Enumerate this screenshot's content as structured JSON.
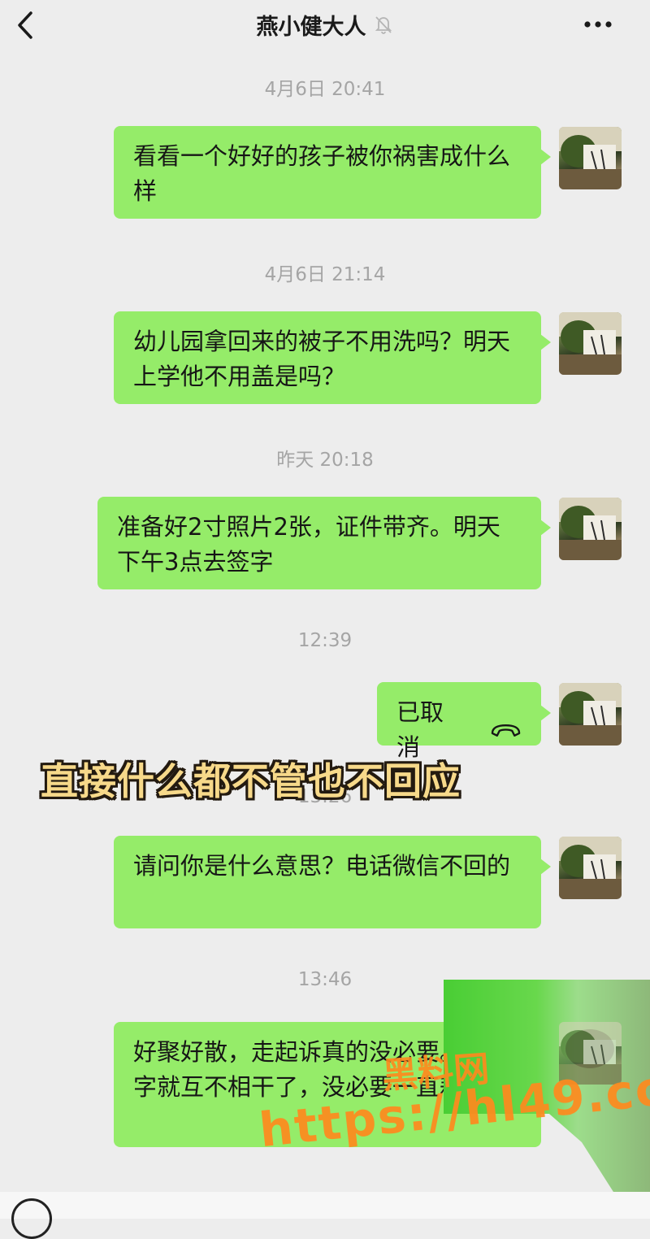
{
  "header": {
    "title": "燕小健大人",
    "back_icon": "chevron-left-icon",
    "mute_icon": "bell-mute-icon",
    "more_icon": "ellipsis-icon"
  },
  "messages": [
    {
      "time": "4月6日 20:41",
      "text": "看看一个好好的孩子被你祸害成什么样"
    },
    {
      "time": "4月6日 21:14",
      "text": "幼儿园拿回来的被子不用洗吗？明天上学他不用盖是吗？"
    },
    {
      "time": "昨天 20:18",
      "text": "准备好2寸照片2张，证件带齐。明天下午3点去签字"
    },
    {
      "time": "12:39",
      "text": "已取消"
    },
    {
      "time": "13:26",
      "text": "请问你是什么意思？电话微信不回的"
    },
    {
      "time": "13:46",
      "text": "好聚好散，走起诉真的没必要。签个字就互不相干了，没必要一直耗着"
    }
  ],
  "overlay_caption": "直接什么都不管也不回应",
  "watermark": {
    "cn": "黑料网",
    "url": "https://hl49.co"
  },
  "colors": {
    "bubble": "#95ec69",
    "background": "#ededed",
    "caption": "#f7d98a",
    "watermark": "#ff8a1e"
  }
}
